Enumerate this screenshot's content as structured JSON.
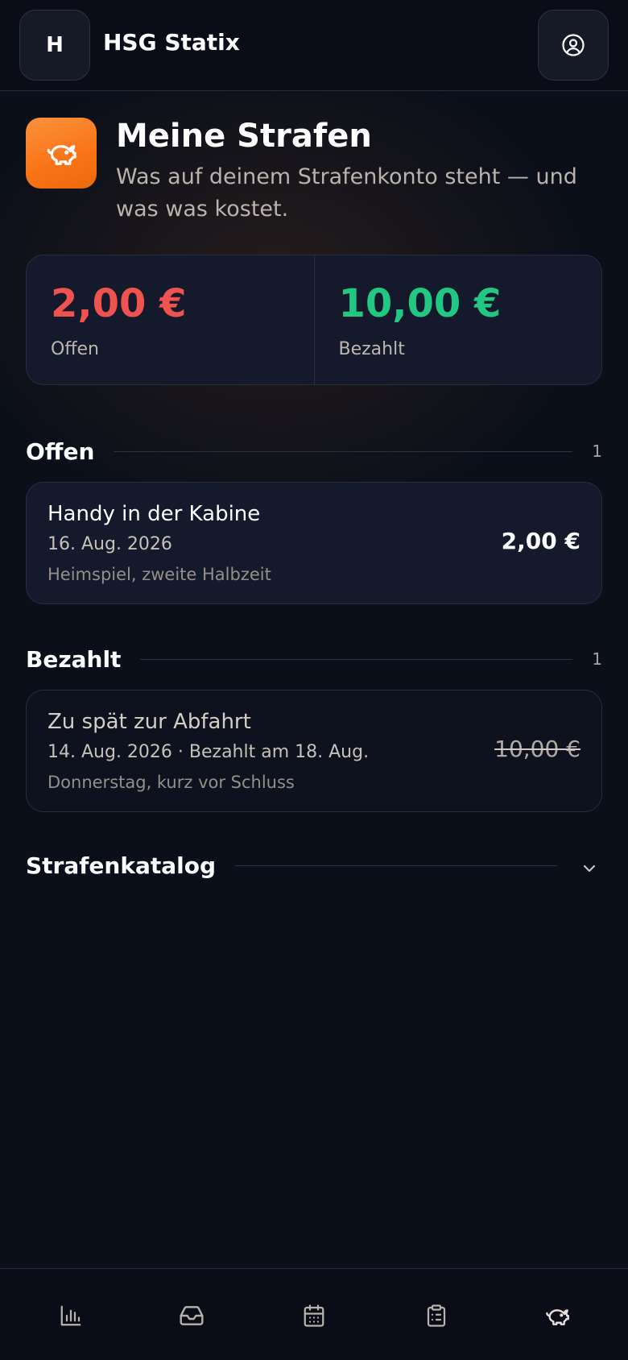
{
  "header": {
    "logo_letter": "H",
    "app_title": "HSG Statix",
    "profile_icon": "user-circle-icon"
  },
  "hero": {
    "icon": "piggy-bank-icon",
    "title": "Meine Strafen",
    "subtitle": "Was auf deinem Strafenkonto steht — und was was kostet."
  },
  "summary": {
    "open_value": "2,00 €",
    "open_label": "Offen",
    "paid_value": "10,00 €",
    "paid_label": "Bezahlt",
    "open_color": "#ef5350",
    "paid_color": "#22c783"
  },
  "sections": {
    "open": {
      "title": "Offen",
      "count": "1",
      "items": [
        {
          "title": "Handy in der Kabine",
          "date": "16. Aug. 2026",
          "note": "Heimspiel, zweite Halbzeit",
          "amount": "2,00 €"
        }
      ]
    },
    "paid": {
      "title": "Bezahlt",
      "count": "1",
      "items": [
        {
          "title": "Zu spät zur Abfahrt",
          "date": "14. Aug. 2026 · Bezahlt am 18. Aug.",
          "note": "Donnerstag, kurz vor Schluss",
          "amount": "10,00 €"
        }
      ]
    },
    "catalog": {
      "title": "Strafenkatalog",
      "toggle_icon": "chevron-down-icon"
    }
  },
  "bottom_nav": {
    "items": [
      "bar-chart-icon",
      "inbox-icon",
      "calendar-icon",
      "clipboard-list-icon",
      "piggy-bank-icon"
    ],
    "active": "piggy-bank-icon"
  }
}
